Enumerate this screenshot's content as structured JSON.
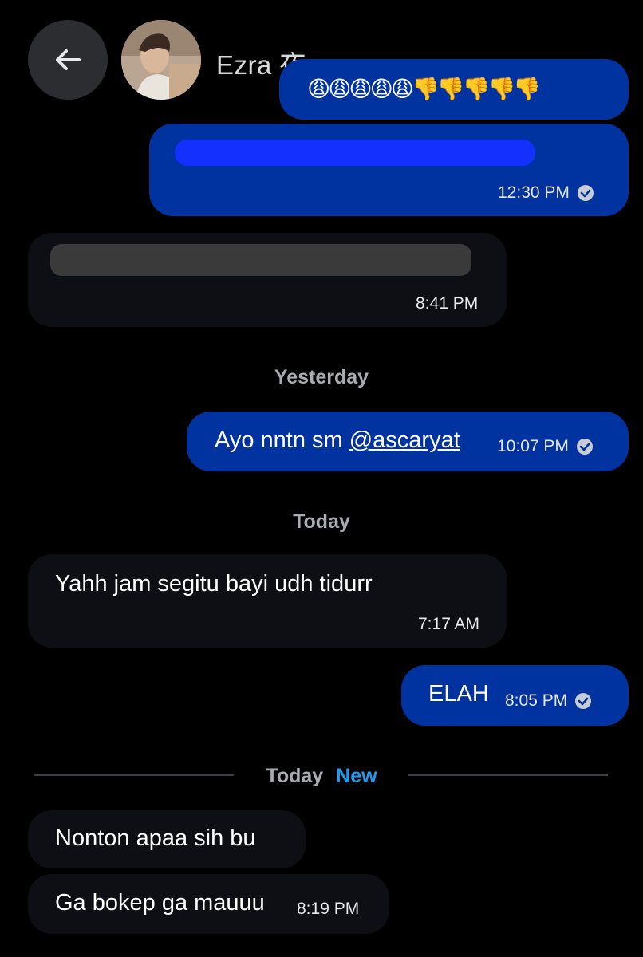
{
  "header": {
    "contact_name": "Ezra 夜"
  },
  "messages": [
    {
      "text": "😩😩😩😩😩👎👎👎👎👎"
    },
    {
      "text": "",
      "time": "12:30 PM"
    },
    {
      "text": "",
      "time": "8:41 PM"
    },
    {
      "text": "Ayo nntn sm ",
      "mention": "@ascaryat",
      "time": "10:07 PM"
    },
    {
      "text": "Yahh jam segitu bayi udh tidurr",
      "time": "7:17 AM"
    },
    {
      "text": "ELAH",
      "time": "8:05 PM"
    },
    {
      "text": "Nonton apaa sih bu"
    },
    {
      "text": "Ga bokep ga mauuu",
      "time": "8:19 PM"
    }
  ],
  "separators": {
    "yesterday": "Yesterday",
    "today": "Today",
    "today_new": "Today",
    "new_label": "New"
  },
  "colors": {
    "sent_bubble": "#0033a0",
    "received_bubble": "#0d0f14",
    "new_accent": "#1d9bf0"
  }
}
